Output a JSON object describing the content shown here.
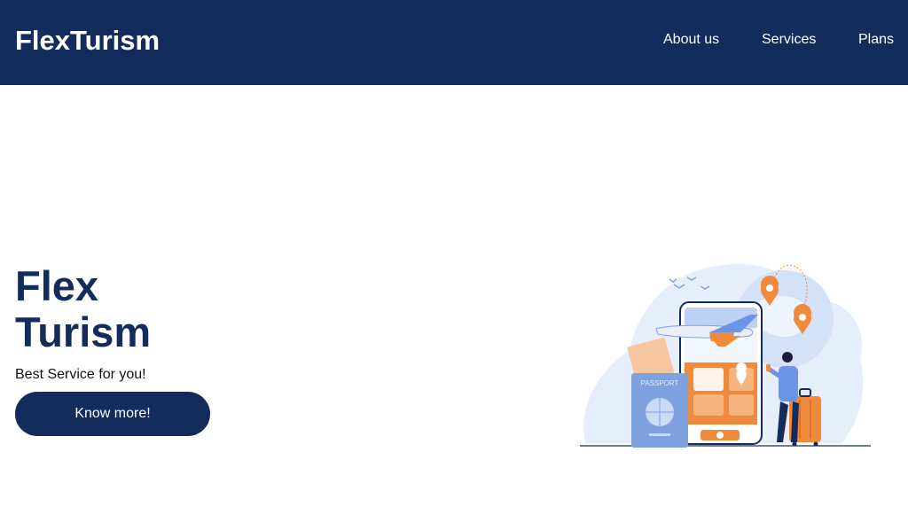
{
  "header": {
    "brand": "FlexTurism",
    "nav": [
      {
        "label": "About us"
      },
      {
        "label": "Services"
      },
      {
        "label": "Plans"
      }
    ]
  },
  "hero": {
    "title_line1": "Flex",
    "title_line2": "Turism",
    "subtitle": "Best Service for you!",
    "cta_label": "Know more!"
  },
  "illustration": {
    "passport_label": "PASSPORT",
    "icons": [
      "airplane-icon",
      "location-pin-icon",
      "globe-icon",
      "suitcase-icon",
      "checkmark-icon"
    ]
  },
  "colors": {
    "primary": "#132c5c",
    "accent_orange": "#f08a3c",
    "accent_blue": "#6b93e6",
    "light_blue": "#e3ecfb"
  }
}
